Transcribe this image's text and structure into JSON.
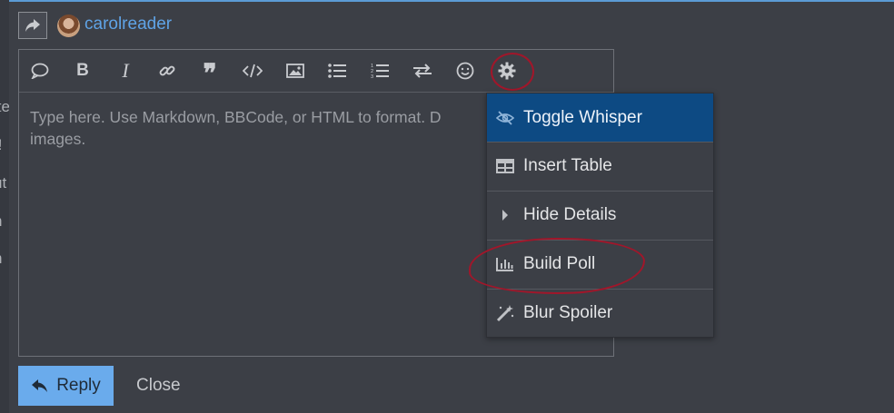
{
  "composer": {
    "username": "carolreader",
    "placeholder": "Type here. Use Markdown, BBCode, or HTML to format. D",
    "placeholder_line2": "images."
  },
  "toolbar_icons": [
    "quote-icon",
    "bold-icon",
    "italic-icon",
    "link-icon",
    "blockquote-icon",
    "code-icon",
    "image-icon",
    "bullet-list-icon",
    "numbered-list-icon",
    "swap-icon",
    "emoji-icon",
    "gear-icon"
  ],
  "menu": {
    "items": [
      {
        "label": "Toggle Whisper",
        "icon": "eye-slash-icon",
        "active": true
      },
      {
        "label": "Insert Table",
        "icon": "table-icon"
      },
      {
        "label": "Hide Details",
        "icon": "caret-right-icon"
      },
      {
        "label": "Build Poll",
        "icon": "chart-bar-icon"
      },
      {
        "label": "Blur Spoiler",
        "icon": "magic-wand-icon"
      }
    ]
  },
  "actions": {
    "reply": "Reply",
    "close": "Close"
  },
  "left_fragments": [
    "ite",
    "t!",
    "ut",
    "n",
    "n"
  ],
  "colors": {
    "accent": "#6aabec",
    "active_menu": "#0d4a83",
    "annotation": "#a1162a",
    "username": "#5fa3e6"
  }
}
